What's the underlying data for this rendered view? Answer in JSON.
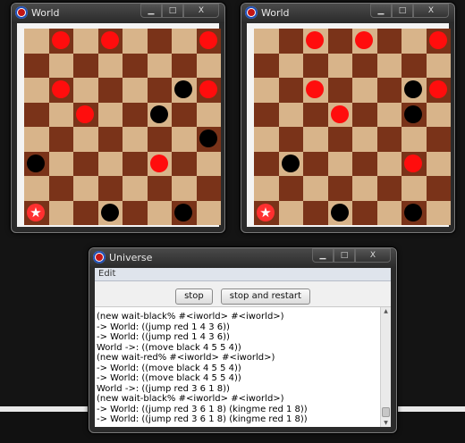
{
  "world_windows": [
    {
      "title": "World",
      "controls": {
        "minimize": "▁",
        "maximize": "□",
        "close": "X"
      },
      "board": [
        ".r.r...r",
        "........",
        ".r....br",
        "..r..b..",
        ".......b",
        "b....r..",
        "........",
        "K..b..b."
      ]
    },
    {
      "title": "World",
      "controls": {
        "minimize": "▁",
        "maximize": "□",
        "close": "X"
      },
      "board": [
        "..r.r..r",
        "........",
        "..r...br",
        "...r..b.",
        "........",
        ".b....r.",
        "........",
        "K..b..b."
      ]
    }
  ],
  "universe": {
    "title": "Universe",
    "controls": {
      "minimize": "▁",
      "maximize": "□",
      "close": "X"
    },
    "menu": {
      "edit": "Edit"
    },
    "buttons": {
      "stop": "stop",
      "stop_restart": "stop and restart"
    },
    "log": [
      "(new wait-black% #<iworld> #<iworld>)",
      "-> World: ((jump red 1 4 3 6))",
      "-> World: ((jump red 1 4 3 6))",
      "World ->: ((move black 4 5 5 4))",
      "(new wait-red% #<iworld> #<iworld>)",
      "-> World: ((move black 4 5 5 4))",
      "-> World: ((move black 4 5 5 4))",
      "World ->: ((jump red 3 6 1 8))",
      "(new wait-black% #<iworld> #<iworld>)",
      "-> World: ((jump red 3 6 1 8) (kingme red 1 8))",
      "-> World: ((jump red 3 6 1 8) (kingme red 1 8))"
    ]
  },
  "colors": {
    "light_square": "#d8b48a",
    "dark_square": "#7a3319",
    "red_piece": "#ff0d0d",
    "black_piece": "#000000"
  },
  "icons": {
    "app": "racket-lambda-icon",
    "king": "star-icon",
    "king_glyph": "★"
  }
}
